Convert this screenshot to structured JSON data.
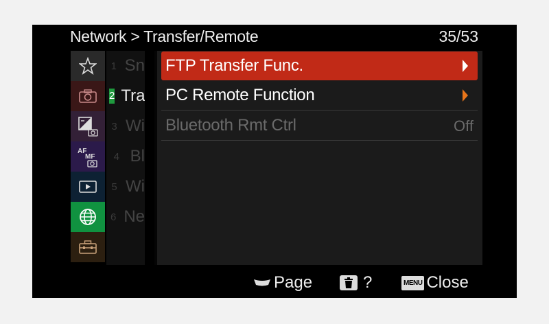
{
  "header": {
    "breadcrumb": "Network > Transfer/Remote",
    "page_count": "35/53"
  },
  "sidebar": {
    "items": [
      {
        "icon": "star-icon"
      },
      {
        "icon": "camera-icon"
      },
      {
        "icon": "exposure-camera-icon"
      },
      {
        "icon": "afmf-icon",
        "text_af": "AF",
        "text_mf": "MF"
      },
      {
        "icon": "play-icon"
      },
      {
        "icon": "globe-icon"
      },
      {
        "icon": "toolbox-icon"
      }
    ]
  },
  "sublist": {
    "items": [
      {
        "num": "1",
        "text": "Sn"
      },
      {
        "num": "2",
        "text": "Tra"
      },
      {
        "num": "3",
        "text": "Wi"
      },
      {
        "num": "4",
        "text": "Bl"
      },
      {
        "num": "5",
        "text": "Wi"
      },
      {
        "num": "6",
        "text": "Ne"
      }
    ]
  },
  "menu": {
    "items": [
      {
        "label": "FTP Transfer Func.",
        "selected": true
      },
      {
        "label": "PC Remote Function"
      },
      {
        "label": "Bluetooth Rmt Ctrl",
        "value": "Off",
        "disabled": true
      }
    ]
  },
  "footer": {
    "page_label": "Page",
    "help_label": "?",
    "menu_icon_text": "MENU",
    "close_label": "Close"
  },
  "colors": {
    "selected_row": "#c12a17",
    "network_tab": "#109240",
    "arrow_orange": "#e8751a"
  }
}
